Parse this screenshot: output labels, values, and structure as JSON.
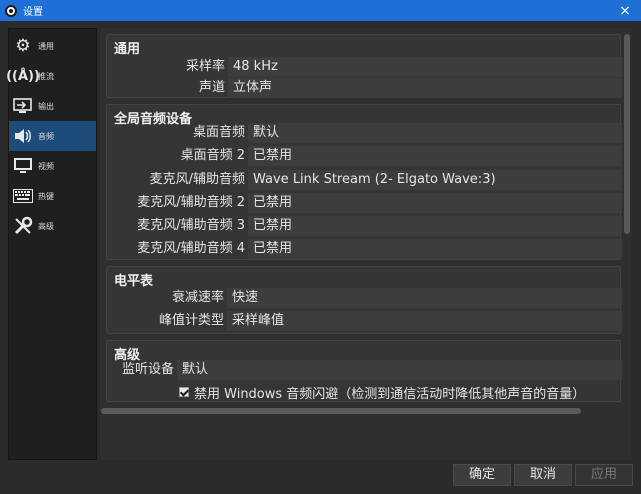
{
  "window": {
    "title": "设置",
    "close_glyph": "×"
  },
  "sidebar": {
    "items": [
      {
        "label": "通用",
        "icon": "gear-icon",
        "glyph": "⚙"
      },
      {
        "label": "推流",
        "icon": "antenna-icon",
        "glyph": "📡"
      },
      {
        "label": "输出",
        "icon": "output-icon",
        "glyph": "⇥"
      },
      {
        "label": "音频",
        "icon": "speaker-icon",
        "glyph": "🔊"
      },
      {
        "label": "视频",
        "icon": "monitor-icon",
        "glyph": "🖥"
      },
      {
        "label": "热键",
        "icon": "keyboard-icon",
        "glyph": "⌨"
      },
      {
        "label": "高级",
        "icon": "wrench-icon",
        "glyph": "🛠"
      }
    ],
    "active_index": 3
  },
  "general": {
    "title": "通用",
    "sample_rate_label": "采样率",
    "sample_rate_value": "48 kHz",
    "channels_label": "声道",
    "channels_value": "立体声"
  },
  "global_audio": {
    "title": "全局音频设备",
    "rows": [
      {
        "label": "桌面音频",
        "value": "默认"
      },
      {
        "label": "桌面音频 2",
        "value": "已禁用"
      },
      {
        "label": "麦克风/辅助音频",
        "value": "Wave Link Stream (2- Elgato Wave:3)"
      },
      {
        "label": "麦克风/辅助音频 2",
        "value": "已禁用"
      },
      {
        "label": "麦克风/辅助音频 3",
        "value": "已禁用"
      },
      {
        "label": "麦克风/辅助音频 4",
        "value": "已禁用"
      }
    ]
  },
  "meters": {
    "title": "电平表",
    "decay_label": "衰减速率",
    "decay_value": "快速",
    "peak_label": "峰值计类型",
    "peak_value": "采样峰值"
  },
  "advanced": {
    "title": "高级",
    "monitor_label": "监听设备",
    "monitor_value": "默认",
    "ducking_checked": true,
    "ducking_label": "禁用 Windows 音频闪避（检测到通信活动时降低其他声音的音量）"
  },
  "buttons": {
    "ok": "确定",
    "cancel": "取消",
    "apply": "应用"
  }
}
